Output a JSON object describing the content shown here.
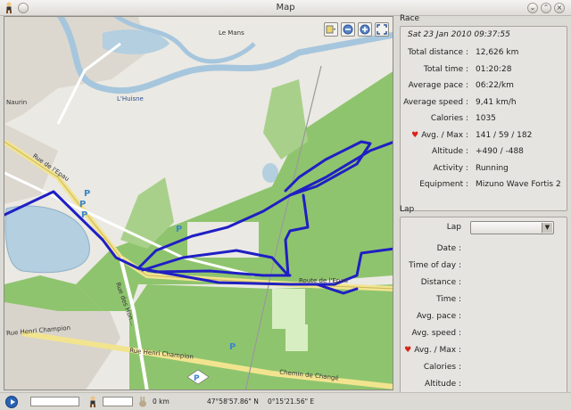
{
  "window": {
    "title": "Map",
    "icon": "runner-icon"
  },
  "colors": {
    "track": "#1f1fc4",
    "forest": "#8fc46e",
    "heart": "#d8241b"
  },
  "map": {
    "labels": {
      "city": "Le Mans",
      "river": "L'Huisne",
      "place": "Naurin",
      "street_1": "Rue de l'Epau",
      "street_2": "Route de l'Epau",
      "street_3": "Rue Henri Champion",
      "street_4": "Chemin de Changé",
      "street_5": "Rue Henri Champion",
      "street_6": "Rue des Hon..."
    },
    "parking_label": "P",
    "tools": [
      "layers-icon",
      "zoom-out-icon",
      "zoom-in-icon",
      "fit-icon"
    ]
  },
  "race": {
    "title": "Race",
    "date": "Sat 23 Jan 2010 09:37:55",
    "rows": [
      {
        "label": "Total distance :",
        "value": "12,626 km"
      },
      {
        "label": "Total time :",
        "value": "01:20:28"
      },
      {
        "label": "Average pace :",
        "value": "06:22/km"
      },
      {
        "label": "Average speed :",
        "value": "9,41 km/h"
      },
      {
        "label": "Calories :",
        "value": "1035"
      },
      {
        "label": "Avg. / Max :",
        "value": "141 / 59 / 182"
      },
      {
        "label": "Altitude :",
        "value": "+490 / -488"
      },
      {
        "label": "Activity :",
        "value": "Running"
      },
      {
        "label": "Equipment :",
        "value": "Mizuno Wave Fortis 2"
      }
    ]
  },
  "lap": {
    "title": "Lap",
    "select_label": "Lap",
    "select_value": "",
    "rows": [
      {
        "label": "Date :"
      },
      {
        "label": "Time of day :"
      },
      {
        "label": "Distance :"
      },
      {
        "label": "Time :"
      },
      {
        "label": "Avg. pace :"
      },
      {
        "label": "Avg. speed :"
      },
      {
        "label": "Avg. / Max :"
      },
      {
        "label": "Calories :"
      },
      {
        "label": "Altitude :"
      }
    ]
  },
  "status": {
    "distance": "0 km",
    "latitude": "47°58'57.86\" N",
    "longitude": "0°15'21.56\" E"
  }
}
